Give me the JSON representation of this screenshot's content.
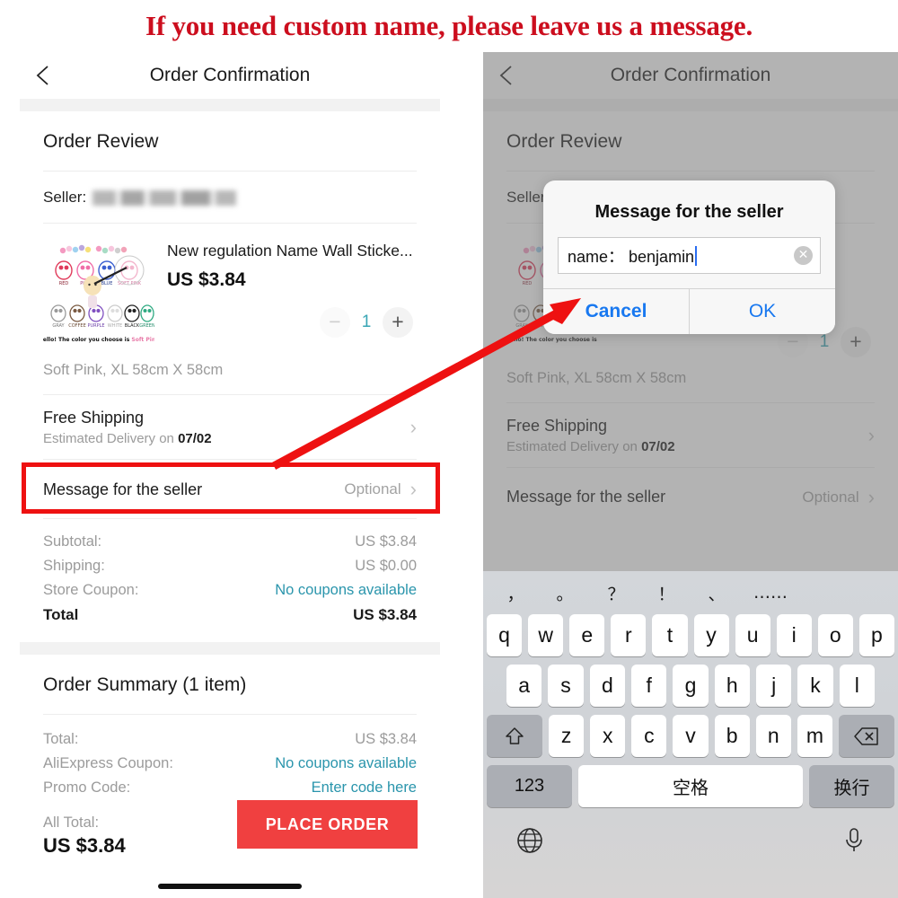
{
  "banner": {
    "text": "If you need custom name, please leave us a message."
  },
  "nav": {
    "title": "Order Confirmation",
    "back_icon": "chevron-left-icon"
  },
  "order_review": {
    "heading": "Order Review",
    "seller_label": "Seller:",
    "product": {
      "title": "New regulation Name Wall Sticke...",
      "price": "US $3.84",
      "variant": "Soft Pink, XL 58cm X 58cm",
      "qty_minus": "−",
      "qty_value": "1",
      "qty_plus": "+"
    },
    "shipping": {
      "title": "Free Shipping",
      "subtitle_prefix": "Estimated Delivery on ",
      "subtitle_date": "07/02",
      "chevron": "›"
    },
    "message_row": {
      "label": "Message for the seller",
      "value": "Optional",
      "chevron": "›"
    },
    "totals": [
      {
        "key": "Subtotal:",
        "value": "US $3.84",
        "link": false
      },
      {
        "key": "Shipping:",
        "value": "US $0.00",
        "link": false
      },
      {
        "key": "Store Coupon:",
        "value": "No coupons available",
        "link": true
      },
      {
        "key": "Total",
        "value": "US $3.84",
        "link": false,
        "strong": true
      }
    ]
  },
  "order_summary": {
    "heading": "Order Summary (1 item)",
    "rows": [
      {
        "key": "Total:",
        "value": "US $3.84",
        "link": false
      },
      {
        "key": "AliExpress Coupon:",
        "value": "No coupons available",
        "link": true
      },
      {
        "key": "Promo Code:",
        "value": "Enter code here",
        "link": true
      }
    ],
    "all_total_label": "All Total:",
    "all_total_value": "US $3.84",
    "place_order_label": "PLACE ORDER"
  },
  "dialog": {
    "title": "Message for the seller",
    "input_value": "name： benjamin",
    "clear_icon": "✕",
    "cancel_label": "Cancel",
    "ok_label": "OK"
  },
  "keyboard": {
    "suggestions": [
      "，",
      "。",
      "？",
      "！",
      "、",
      "……"
    ],
    "row1": [
      "q",
      "w",
      "e",
      "r",
      "t",
      "y",
      "u",
      "i",
      "o",
      "p"
    ],
    "row2": [
      "a",
      "s",
      "d",
      "f",
      "g",
      "h",
      "j",
      "k",
      "l"
    ],
    "row3": [
      "z",
      "x",
      "c",
      "v",
      "b",
      "n",
      "m"
    ],
    "shift_icon": "shift-icon",
    "backspace_icon": "backspace-icon",
    "numbers_label": "123",
    "space_label": "空格",
    "return_label": "换行",
    "globe_icon": "globe-icon",
    "mic_icon": "microphone-icon"
  },
  "annotations": {
    "highlight_box_color": "#ee1111",
    "arrow_color": "#ee1111"
  },
  "colors": {
    "accent_red": "#f04040",
    "link_teal": "#2a95ac",
    "ios_blue": "#1878f0",
    "qty_teal": "#39a6b5"
  }
}
